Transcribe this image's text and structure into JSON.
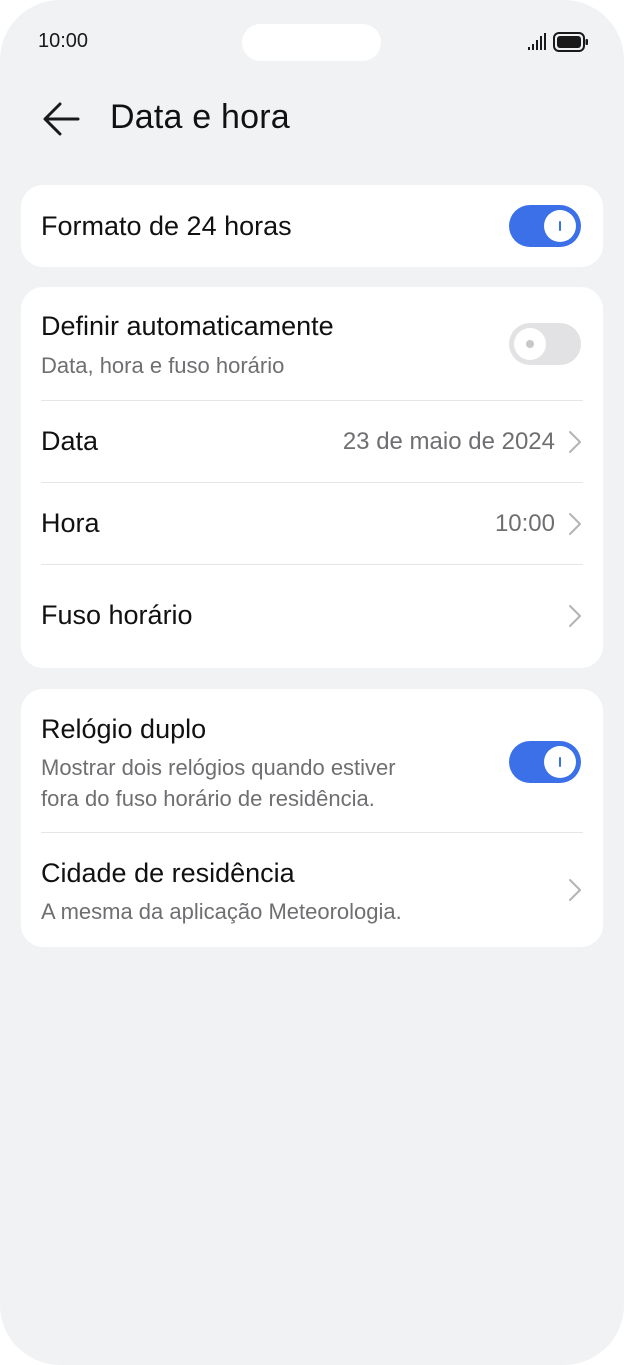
{
  "status_bar": {
    "time": "10:00",
    "signal_icon": "signal-icon",
    "battery_icon": "battery-icon"
  },
  "header": {
    "back_icon": "arrow-left-icon",
    "title": "Data e hora"
  },
  "settings": {
    "format_24h": {
      "title": "Formato de 24 horas",
      "enabled": true
    },
    "auto_set": {
      "title": "Definir automaticamente",
      "subtitle": "Data, hora e fuso horário",
      "enabled": false
    },
    "date": {
      "title": "Data",
      "value": "23 de maio de 2024"
    },
    "time": {
      "title": "Hora",
      "value": "10:00"
    },
    "timezone": {
      "title": "Fuso horário"
    },
    "dual_clock": {
      "title": "Relógio duplo",
      "subtitle_line1": "Mostrar dois relógios quando estiver",
      "subtitle_line2": "fora do fuso horário de residência.",
      "enabled": true
    },
    "home_city": {
      "title": "Cidade de residência",
      "subtitle": "A mesma da aplicação Meteorologia."
    }
  },
  "colors": {
    "accent": "#3b70e9",
    "background": "#f1f2f4",
    "card": "#ffffff",
    "toggle_off": "#e2e2e4"
  }
}
